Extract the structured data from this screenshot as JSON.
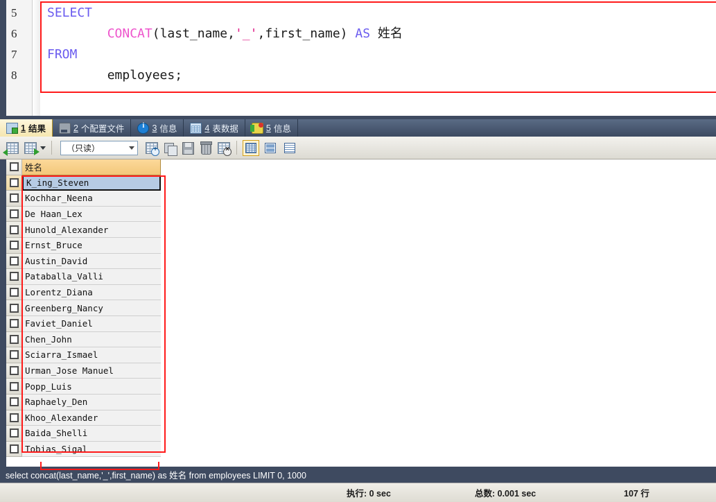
{
  "editor": {
    "line_numbers": [
      "5",
      "6",
      "7",
      "8"
    ],
    "lines": [
      {
        "keyword": "SELECT"
      },
      {
        "fn": "CONCAT",
        "open": "(",
        "ident1": "last_name,",
        "str": "'_'",
        "comma": ",",
        "ident2": "first_name)",
        "as": "AS",
        "alias": "姓名"
      },
      {
        "keyword": "FROM"
      },
      {
        "table": "employees;"
      }
    ]
  },
  "tabs": [
    {
      "num": "1",
      "label": "结果",
      "icon": "result-grid-icon",
      "active": true
    },
    {
      "num": "2",
      "label": "个配置文件",
      "icon": "profile-icon",
      "active": false
    },
    {
      "num": "3",
      "label": "信息",
      "icon": "info-icon",
      "active": false
    },
    {
      "num": "4",
      "label": "表数据",
      "icon": "table-data-icon",
      "active": false
    },
    {
      "num": "5",
      "label": "信息",
      "icon": "status-icon",
      "active": false
    }
  ],
  "toolbar": {
    "insert_row_icon": "insert-row-icon",
    "export_row_icon": "export-row-icon",
    "dropdown_caret_icon": "chevron-down-icon",
    "readonly_value": "（只读）",
    "readonly_chevron_icon": "chevron-down-icon",
    "buttons": [
      {
        "name": "add-record-button",
        "icon": "grid-add-icon"
      },
      {
        "name": "refresh-record-button",
        "icon": "grid-refresh-icon"
      },
      {
        "name": "apply-changes-button",
        "icon": "save-disk-icon"
      },
      {
        "name": "delete-record-button",
        "icon": "trash-icon"
      },
      {
        "name": "revert-changes-button",
        "icon": "grid-cancel-icon"
      }
    ],
    "view_modes": [
      {
        "name": "view-mode-grid",
        "icon": "grid-view-icon",
        "active": true
      },
      {
        "name": "view-mode-form",
        "icon": "form-view-icon",
        "active": false
      },
      {
        "name": "view-mode-text",
        "icon": "text-view-icon",
        "active": false
      }
    ]
  },
  "grid": {
    "columns": [
      "姓名"
    ],
    "rows": [
      "K_ing_Steven",
      "Kochhar_Neena",
      "De Haan_Lex",
      "Hunold_Alexander",
      "Ernst_Bruce",
      "Austin_David",
      "Pataballa_Valli",
      "Lorentz_Diana",
      "Greenberg_Nancy",
      "Faviet_Daniel",
      "Chen_John",
      "Sciarra_Ismael",
      "Urman_Jose Manuel",
      "Popp_Luis",
      "Raphaely_Den",
      "Khoo_Alexander",
      "Baida_Shelli",
      "Tobias_Sigal"
    ],
    "selected_row_index": 0
  },
  "query_status": {
    "text": "select concat(last_name,'_',first_name) as 姓名 from employees LIMIT 0, 1000"
  },
  "status_bar": {
    "exec_time": "执行: 0 sec",
    "total_time": "总数: 0.001 sec",
    "row_count": "107 行"
  },
  "colors": {
    "keyword": "#6a5bef",
    "function": "#ee55cc",
    "string": "#e0218a",
    "highlight_box": "#ff1a1a",
    "header_bg": "#f3c77a",
    "selection_bg": "#b6cbe4",
    "chrome_dark": "#3e4a60",
    "tab_active": "#f5e6b0"
  }
}
